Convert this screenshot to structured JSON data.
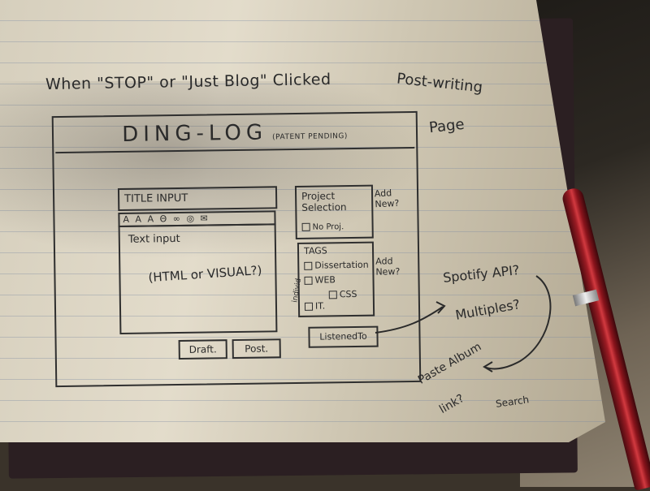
{
  "note": {
    "heading": "When \"STOP\" or \"Just Blog\" Clicked",
    "page_title_line1": "Post-writing",
    "page_title_line2": "Page"
  },
  "app": {
    "title": "DING-LOG",
    "patent_note": "(PATENT PENDING)"
  },
  "editor": {
    "title_input_label": "TITLE INPUT",
    "toolbar_items": [
      "A",
      "A",
      "A",
      "Θ",
      "∞",
      "◎",
      "✉"
    ],
    "text_input_label": "Text input",
    "text_input_hint": "(HTML or VISUAL?)"
  },
  "buttons": {
    "draft_label": "Draft.",
    "post_label": "Post."
  },
  "project": {
    "label": "Project Selection",
    "no_project_label": "No Proj.",
    "add_new": "Add New?"
  },
  "tags": {
    "label": "TAGS",
    "items": [
      "Dissertation",
      "WEB",
      "CSS",
      "IT."
    ],
    "add_new": "Add New?",
    "side_note": "individ"
  },
  "listened_to": {
    "label": "ListenedTo"
  },
  "annotations": {
    "spotify": "Spotify API?",
    "multiples": "Multiples?",
    "paste_album": "Paste Album",
    "link": "link?",
    "search": "Search"
  }
}
